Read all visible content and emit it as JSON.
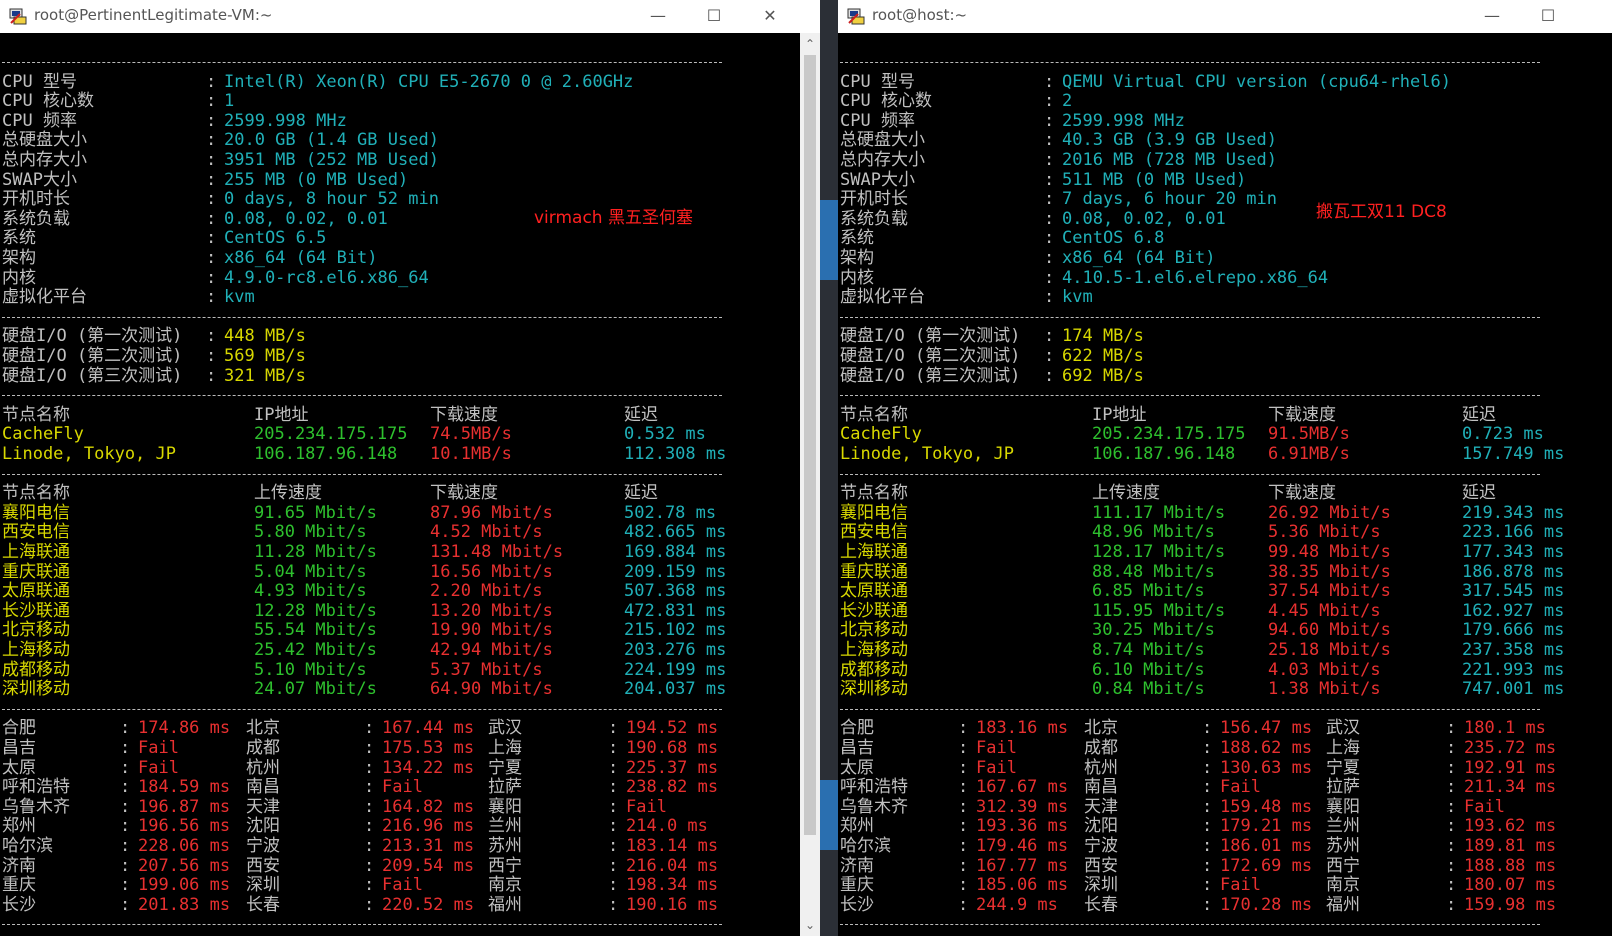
{
  "left": {
    "title": "root@PertinentLegitimate-VM:~",
    "annotation": "virmach 黑五圣何塞",
    "sysinfo": [
      {
        "label": "CPU 型号",
        "value": "Intel(R) Xeon(R) CPU E5-2670 0 @ 2.60GHz"
      },
      {
        "label": "CPU 核心数",
        "value": "1"
      },
      {
        "label": "CPU 频率",
        "value": "2599.998 MHz"
      },
      {
        "label": "总硬盘大小",
        "value": "20.0 GB (1.4 GB Used)"
      },
      {
        "label": "总内存大小",
        "value": "3951 MB (252 MB Used)"
      },
      {
        "label": "SWAP大小",
        "value": "255 MB (0 MB Used)"
      },
      {
        "label": "开机时长",
        "value": "0 days, 8 hour 52 min"
      },
      {
        "label": "系统负载",
        "value": "0.08, 0.02, 0.01"
      },
      {
        "label": "系统",
        "value": "CentOS 6.5"
      },
      {
        "label": "架构",
        "value": "x86_64 (64 Bit)"
      },
      {
        "label": "内核",
        "value": "4.9.0-rc8.el6.x86_64"
      },
      {
        "label": "虚拟化平台",
        "value": "kvm"
      }
    ],
    "io": [
      {
        "label": "硬盘I/O (第一次测试)",
        "value": "448 MB/s"
      },
      {
        "label": "硬盘I/O (第二次测试)",
        "value": "569 MB/s"
      },
      {
        "label": "硬盘I/O (第三次测试)",
        "value": "321 MB/s"
      }
    ],
    "dl_headers": [
      "节点名称",
      "IP地址",
      "下载速度",
      "延迟"
    ],
    "dl_rows": [
      [
        "CacheFly",
        "205.234.175.175",
        "74.5MB/s",
        "0.532 ms"
      ],
      [
        "Linode, Tokyo, JP",
        "106.187.96.148",
        "10.1MB/s",
        "112.308 ms"
      ]
    ],
    "sp_headers": [
      "节点名称",
      "上传速度",
      "下载速度",
      "延迟"
    ],
    "sp_rows": [
      [
        "襄阳电信",
        "91.65 Mbit/s",
        "87.96 Mbit/s",
        "502.78 ms"
      ],
      [
        "西安电信",
        "5.80 Mbit/s",
        "4.52 Mbit/s",
        "482.665 ms"
      ],
      [
        "上海联通",
        "11.28 Mbit/s",
        "131.48 Mbit/s",
        "169.884 ms"
      ],
      [
        "重庆联通",
        "5.04 Mbit/s",
        "16.56 Mbit/s",
        "209.159 ms"
      ],
      [
        "太原联通",
        "4.93 Mbit/s",
        "2.20 Mbit/s",
        "507.368 ms"
      ],
      [
        "长沙联通",
        "12.28 Mbit/s",
        "13.20 Mbit/s",
        "472.831 ms"
      ],
      [
        "北京移动",
        "55.54 Mbit/s",
        "19.90 Mbit/s",
        "215.102 ms"
      ],
      [
        "上海移动",
        "25.42 Mbit/s",
        "42.94 Mbit/s",
        "203.276 ms"
      ],
      [
        "成都移动",
        "5.10 Mbit/s",
        "5.37 Mbit/s",
        "224.199 ms"
      ],
      [
        "深圳移动",
        "24.07 Mbit/s",
        "64.90 Mbit/s",
        "204.037 ms"
      ]
    ],
    "ping_rows": [
      [
        [
          "合肥",
          "174.86 ms"
        ],
        [
          "北京",
          "167.44 ms"
        ],
        [
          "武汉",
          "194.52 ms"
        ]
      ],
      [
        [
          "昌吉",
          "Fail"
        ],
        [
          "成都",
          "175.53 ms"
        ],
        [
          "上海",
          "190.68 ms"
        ]
      ],
      [
        [
          "太原",
          "Fail"
        ],
        [
          "杭州",
          "134.22 ms"
        ],
        [
          "宁夏",
          "225.37 ms"
        ]
      ],
      [
        [
          "呼和浩特",
          "184.59 ms"
        ],
        [
          "南昌",
          "Fail"
        ],
        [
          "拉萨",
          "238.82 ms"
        ]
      ],
      [
        [
          "乌鲁木齐",
          "196.87 ms"
        ],
        [
          "天津",
          "164.82 ms"
        ],
        [
          "襄阳",
          "Fail"
        ]
      ],
      [
        [
          "郑州",
          "196.56 ms"
        ],
        [
          "沈阳",
          "216.96 ms"
        ],
        [
          "兰州",
          "214.0 ms"
        ]
      ],
      [
        [
          "哈尔滨",
          "228.06 ms"
        ],
        [
          "宁波",
          "213.31 ms"
        ],
        [
          "苏州",
          "183.14 ms"
        ]
      ],
      [
        [
          "济南",
          "207.56 ms"
        ],
        [
          "西安",
          "209.54 ms"
        ],
        [
          "西宁",
          "216.04 ms"
        ]
      ],
      [
        [
          "重庆",
          "199.06 ms"
        ],
        [
          "深圳",
          "Fail"
        ],
        [
          "南京",
          "198.34 ms"
        ]
      ],
      [
        [
          "长沙",
          "201.83 ms"
        ],
        [
          "长春",
          "220.52 ms"
        ],
        [
          "福州",
          "190.16 ms"
        ]
      ]
    ]
  },
  "right": {
    "title": "root@host:~",
    "annotation": "搬瓦工双11 DC8",
    "sysinfo": [
      {
        "label": "CPU 型号",
        "value": "QEMU Virtual CPU version (cpu64-rhel6)"
      },
      {
        "label": "CPU 核心数",
        "value": "2"
      },
      {
        "label": "CPU 频率",
        "value": "2599.998 MHz"
      },
      {
        "label": "总硬盘大小",
        "value": "40.3 GB (3.9 GB Used)"
      },
      {
        "label": "总内存大小",
        "value": "2016 MB (728 MB Used)"
      },
      {
        "label": "SWAP大小",
        "value": "511 MB (0 MB Used)"
      },
      {
        "label": "开机时长",
        "value": "7 days, 6 hour 20 min"
      },
      {
        "label": "系统负载",
        "value": "0.08, 0.02, 0.01"
      },
      {
        "label": "系统",
        "value": "CentOS 6.8"
      },
      {
        "label": "架构",
        "value": "x86_64 (64 Bit)"
      },
      {
        "label": "内核",
        "value": "4.10.5-1.el6.elrepo.x86_64"
      },
      {
        "label": "虚拟化平台",
        "value": "kvm"
      }
    ],
    "io": [
      {
        "label": "硬盘I/O (第一次测试)",
        "value": "174 MB/s"
      },
      {
        "label": "硬盘I/O (第二次测试)",
        "value": "622 MB/s"
      },
      {
        "label": "硬盘I/O (第三次测试)",
        "value": "692 MB/s"
      }
    ],
    "dl_headers": [
      "节点名称",
      "IP地址",
      "下载速度",
      "延迟"
    ],
    "dl_rows": [
      [
        "CacheFly",
        "205.234.175.175",
        "91.5MB/s",
        "0.723 ms"
      ],
      [
        "Linode, Tokyo, JP",
        "106.187.96.148",
        "6.91MB/s",
        "157.749 ms"
      ]
    ],
    "sp_headers": [
      "节点名称",
      "上传速度",
      "下载速度",
      "延迟"
    ],
    "sp_rows": [
      [
        "襄阳电信",
        "111.17 Mbit/s",
        "26.92 Mbit/s",
        "219.343 ms"
      ],
      [
        "西安电信",
        "48.96 Mbit/s",
        "5.36 Mbit/s",
        "223.166 ms"
      ],
      [
        "上海联通",
        "128.17 Mbit/s",
        "99.48 Mbit/s",
        "177.343 ms"
      ],
      [
        "重庆联通",
        "88.48 Mbit/s",
        "38.35 Mbit/s",
        "186.878 ms"
      ],
      [
        "太原联通",
        "6.85 Mbit/s",
        "37.54 Mbit/s",
        "317.545 ms"
      ],
      [
        "长沙联通",
        "115.95 Mbit/s",
        "4.45 Mbit/s",
        "162.927 ms"
      ],
      [
        "北京移动",
        "30.25 Mbit/s",
        "94.60 Mbit/s",
        "179.666 ms"
      ],
      [
        "上海移动",
        "8.74 Mbit/s",
        "25.18 Mbit/s",
        "237.358 ms"
      ],
      [
        "成都移动",
        "6.10 Mbit/s",
        "4.03 Mbit/s",
        "221.993 ms"
      ],
      [
        "深圳移动",
        "0.84 Mbit/s",
        "1.38 Mbit/s",
        "747.001 ms"
      ]
    ],
    "ping_rows": [
      [
        [
          "合肥",
          "183.16 ms"
        ],
        [
          "北京",
          "156.47 ms"
        ],
        [
          "武汉",
          "180.1 ms"
        ]
      ],
      [
        [
          "昌吉",
          "Fail"
        ],
        [
          "成都",
          "188.62 ms"
        ],
        [
          "上海",
          "235.72 ms"
        ]
      ],
      [
        [
          "太原",
          "Fail"
        ],
        [
          "杭州",
          "130.63 ms"
        ],
        [
          "宁夏",
          "192.91 ms"
        ]
      ],
      [
        [
          "呼和浩特",
          "167.67 ms"
        ],
        [
          "南昌",
          "Fail"
        ],
        [
          "拉萨",
          "211.34 ms"
        ]
      ],
      [
        [
          "乌鲁木齐",
          "312.39 ms"
        ],
        [
          "天津",
          "159.48 ms"
        ],
        [
          "襄阳",
          "Fail"
        ]
      ],
      [
        [
          "郑州",
          "193.36 ms"
        ],
        [
          "沈阳",
          "179.21 ms"
        ],
        [
          "兰州",
          "193.62 ms"
        ]
      ],
      [
        [
          "哈尔滨",
          "179.46 ms"
        ],
        [
          "宁波",
          "186.01 ms"
        ],
        [
          "苏州",
          "189.81 ms"
        ]
      ],
      [
        [
          "济南",
          "167.77 ms"
        ],
        [
          "西安",
          "172.69 ms"
        ],
        [
          "西宁",
          "188.88 ms"
        ]
      ],
      [
        [
          "重庆",
          "185.06 ms"
        ],
        [
          "深圳",
          "Fail"
        ],
        [
          "南京",
          "180.07 ms"
        ]
      ],
      [
        [
          "长沙",
          "244.9 ms"
        ],
        [
          "长春",
          "170.28 ms"
        ],
        [
          "福州",
          "159.98 ms"
        ]
      ]
    ]
  },
  "colors": {
    "label": "#c0c0c0",
    "value": "#20b0b8",
    "yellow": "#d8d800",
    "green": "#2ec02e",
    "red": "#e83030"
  },
  "icons": {
    "app": "putty-icon",
    "minimize": "minimize-icon",
    "maximize": "maximize-icon",
    "close": "close-icon"
  }
}
